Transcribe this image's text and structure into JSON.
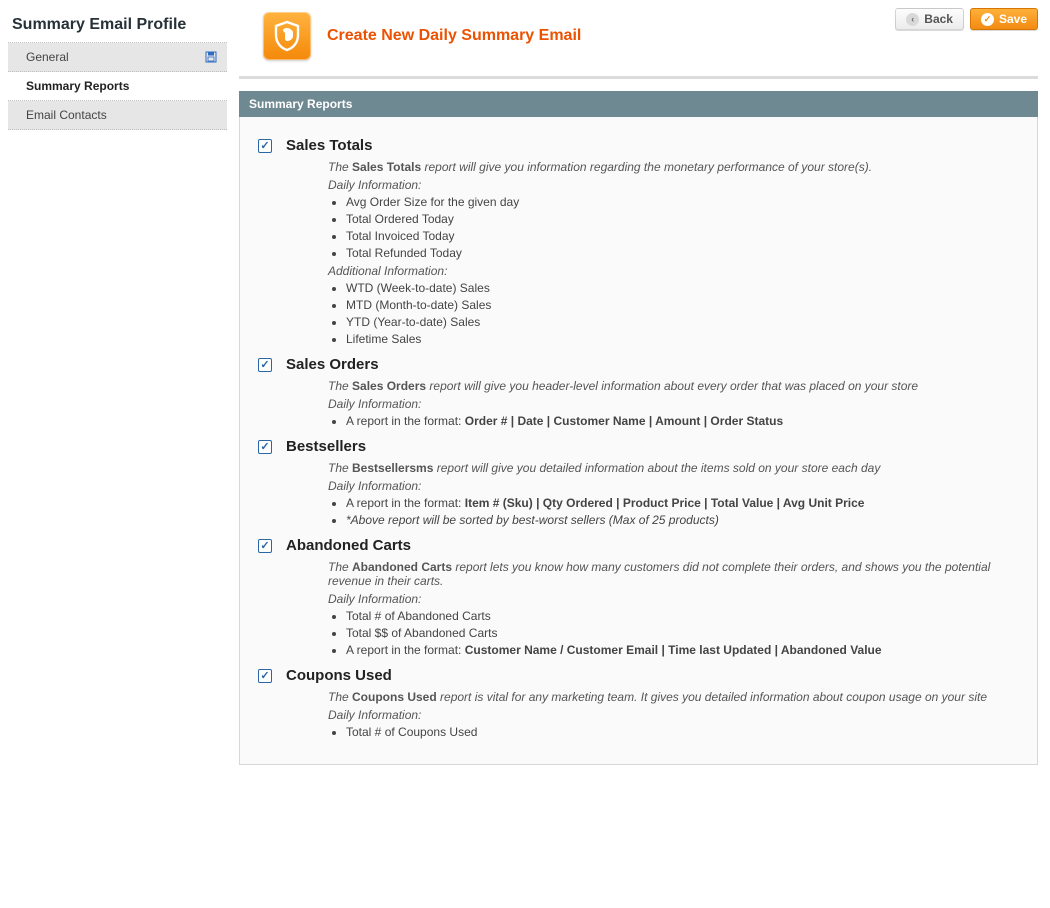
{
  "sidebar": {
    "title": "Summary Email Profile",
    "tabs": [
      {
        "label": "General",
        "active": false,
        "hasSaveIndicator": true
      },
      {
        "label": "Summary Reports",
        "active": true,
        "hasSaveIndicator": false
      },
      {
        "label": "Email Contacts",
        "active": false,
        "hasSaveIndicator": false
      }
    ]
  },
  "buttons": {
    "back": "Back",
    "save": "Save"
  },
  "header": {
    "icon": "shield-dog-icon",
    "title": "Create New Daily Summary Email"
  },
  "panel": {
    "title": "Summary Reports"
  },
  "reports": [
    {
      "key": "sales-totals",
      "title": "Sales Totals",
      "checked": true,
      "desc_pre": "The ",
      "desc_bold": "Sales Totals",
      "desc_post": " report will give you information regarding the monetary performance of your store(s).",
      "sections": [
        {
          "heading": "Daily Information:",
          "items": [
            {
              "text": "Avg Order Size for the given day"
            },
            {
              "text": "Total Ordered Today"
            },
            {
              "text": "Total Invoiced Today"
            },
            {
              "text": "Total Refunded Today"
            }
          ]
        },
        {
          "heading": "Additional Information:",
          "items": [
            {
              "text": "WTD (Week-to-date) Sales"
            },
            {
              "text": "MTD (Month-to-date) Sales"
            },
            {
              "text": "YTD (Year-to-date) Sales"
            },
            {
              "text": "Lifetime Sales"
            }
          ]
        }
      ]
    },
    {
      "key": "sales-orders",
      "title": "Sales Orders",
      "checked": true,
      "desc_pre": "The ",
      "desc_bold": "Sales Orders",
      "desc_post": " report will give you header-level information about every order that was placed on your store",
      "sections": [
        {
          "heading": "Daily Information:",
          "items": [
            {
              "pre": "A report in the format: ",
              "bold": "Order # | Date | Customer Name | Amount | Order Status"
            }
          ]
        }
      ]
    },
    {
      "key": "bestsellers",
      "title": "Bestsellers",
      "checked": true,
      "desc_pre": "The ",
      "desc_bold": "Bestsellersms",
      "desc_post": " report will give you detailed information about the items sold on your store each day",
      "sections": [
        {
          "heading": "Daily Information:",
          "items": [
            {
              "pre": "A report in the format: ",
              "bold": "Item # (Sku) | Qty Ordered | Product Price | Total Value | Avg Unit Price"
            },
            {
              "italic": "*Above report will be sorted by best-worst sellers (Max of 25 products)"
            }
          ]
        }
      ]
    },
    {
      "key": "abandoned-carts",
      "title": "Abandoned Carts",
      "checked": true,
      "desc_pre": "The ",
      "desc_bold": "Abandoned Carts",
      "desc_post": " report lets you know how many customers did not complete their orders, and shows you the potential revenue in their carts.",
      "sections": [
        {
          "heading": "Daily Information:",
          "items": [
            {
              "text": "Total # of Abandoned Carts"
            },
            {
              "text": "Total $$ of Abandoned Carts"
            },
            {
              "pre": "A report in the format: ",
              "bold": "Customer Name / Customer Email | Time last Updated | Abandoned Value"
            }
          ]
        }
      ]
    },
    {
      "key": "coupons-used",
      "title": "Coupons Used",
      "checked": true,
      "desc_pre": "The ",
      "desc_bold": "Coupons Used",
      "desc_post": " report is vital for any marketing team. It gives you detailed information about coupon usage on your site",
      "sections": [
        {
          "heading": "Daily Information:",
          "items": [
            {
              "text": "Total # of Coupons Used"
            }
          ]
        }
      ]
    }
  ]
}
